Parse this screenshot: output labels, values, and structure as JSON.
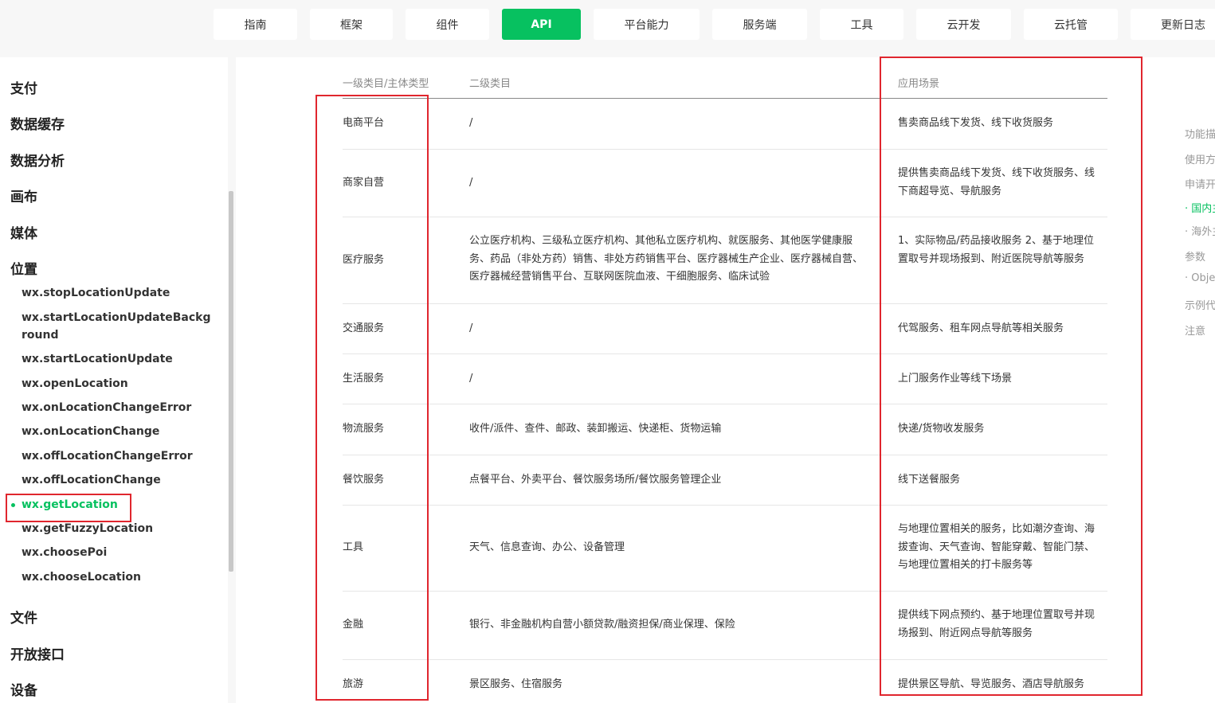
{
  "top_nav": {
    "tabs": [
      {
        "label": "指南",
        "active": false
      },
      {
        "label": "框架",
        "active": false
      },
      {
        "label": "组件",
        "active": false
      },
      {
        "label": "API",
        "active": true
      },
      {
        "label": "平台能力",
        "active": false
      },
      {
        "label": "服务端",
        "active": false
      },
      {
        "label": "工具",
        "active": false
      },
      {
        "label": "云开发",
        "active": false
      },
      {
        "label": "云托管",
        "active": false
      },
      {
        "label": "更新日志",
        "active": false
      }
    ]
  },
  "sidebar": {
    "categories_top": [
      "支付",
      "数据缓存",
      "数据分析",
      "画布",
      "媒体",
      "位置"
    ],
    "location_items": [
      {
        "label": "wx.stopLocationUpdate",
        "active": false
      },
      {
        "label": "wx.startLocationUpdateBackground",
        "active": false
      },
      {
        "label": "wx.startLocationUpdate",
        "active": false
      },
      {
        "label": "wx.openLocation",
        "active": false
      },
      {
        "label": "wx.onLocationChangeError",
        "active": false
      },
      {
        "label": "wx.onLocationChange",
        "active": false
      },
      {
        "label": "wx.offLocationChangeError",
        "active": false
      },
      {
        "label": "wx.offLocationChange",
        "active": false
      },
      {
        "label": "wx.getLocation",
        "active": true
      },
      {
        "label": "wx.getFuzzyLocation",
        "active": false
      },
      {
        "label": "wx.choosePoi",
        "active": false
      },
      {
        "label": "wx.chooseLocation",
        "active": false
      }
    ],
    "categories_bottom": [
      "文件",
      "开放接口",
      "设备"
    ]
  },
  "table": {
    "headers": [
      "一级类目/主体类型",
      "二级类目",
      "应用场景"
    ],
    "rows": [
      {
        "primary": "电商平台",
        "secondary": "/",
        "scenario": "售卖商品线下发货、线下收货服务"
      },
      {
        "primary": "商家自营",
        "secondary": "/",
        "scenario": "提供售卖商品线下发货、线下收货服务、线下商超导览、导航服务"
      },
      {
        "primary": "医疗服务",
        "secondary": "公立医疗机构、三级私立医疗机构、其他私立医疗机构、就医服务、其他医学健康服务、药品（非处方药）销售、非处方药销售平台、医疗器械生产企业、医疗器械自营、医疗器械经营销售平台、互联网医院血液、干细胞服务、临床试验",
        "scenario": "1、实际物品/药品接收服务 2、基于地理位置取号并现场报到、附近医院导航等服务"
      },
      {
        "primary": "交通服务",
        "secondary": "/",
        "scenario": "代驾服务、租车网点导航等相关服务"
      },
      {
        "primary": "生活服务",
        "secondary": "/",
        "scenario": "上门服务作业等线下场景"
      },
      {
        "primary": "物流服务",
        "secondary": "收件/派件、查件、邮政、装卸搬运、快递柜、货物运输",
        "scenario": "快递/货物收发服务"
      },
      {
        "primary": "餐饮服务",
        "secondary": "点餐平台、外卖平台、餐饮服务场所/餐饮服务管理企业",
        "scenario": "线下送餐服务"
      },
      {
        "primary": "工具",
        "secondary": "天气、信息查询、办公、设备管理",
        "scenario": "与地理位置相关的服务，比如潮汐查询、海拔查询、天气查询、智能穿戴、智能门禁、与地理位置相关的打卡服务等"
      },
      {
        "primary": "金融",
        "secondary": "银行、非金融机构自营小额贷款/融资担保/商业保理、保险",
        "scenario": "提供线下网点预约、基于地理位置取号并现场报到、附近网点导航等服务"
      },
      {
        "primary": "旅游",
        "secondary": "景区服务、住宿服务",
        "scenario": "提供景区导航、导览服务、酒店导航服务"
      }
    ]
  },
  "toc": {
    "items": [
      {
        "label": "功能描述",
        "active": false
      },
      {
        "label": "使用方法",
        "active": false
      },
      {
        "label": "申请开通",
        "active": false
      },
      {
        "label": "· 国内主体",
        "active": true
      },
      {
        "label": "· 海外主体",
        "active": false
      },
      {
        "label": "参数",
        "active": false
      },
      {
        "label": "· Object object",
        "active": false
      },
      {
        "label": "示例代码",
        "active": false
      },
      {
        "label": "注意",
        "active": false
      }
    ]
  },
  "colors": {
    "accent": "#07c160",
    "highlight_box": "#e0262e",
    "nav_bg": "#f7f7f7"
  }
}
